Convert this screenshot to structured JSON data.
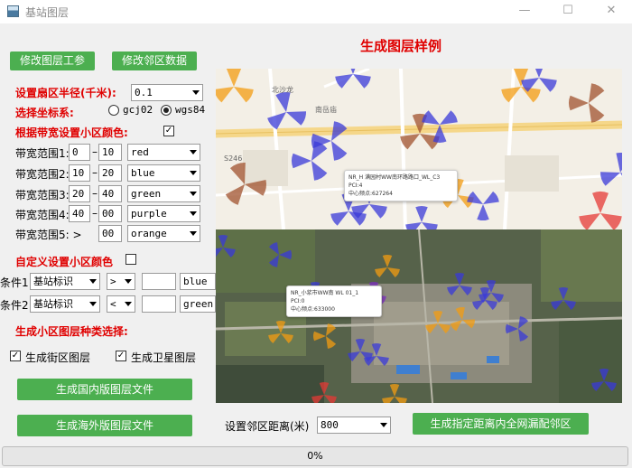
{
  "window": {
    "title": "基站图层",
    "minimize": "—",
    "maximize": "☐",
    "close": "✕"
  },
  "toolbar": {
    "modify_params": "修改图层工参",
    "modify_neighbor": "修改邻区数据"
  },
  "preview_title": "生成图层样例",
  "sector_radius": {
    "label": "设置扇区半径(千米):",
    "value": "0.1"
  },
  "coord": {
    "label": "选择坐标系:",
    "options": [
      "gcj02",
      "wgs84"
    ],
    "selected": "wgs84"
  },
  "bandwidth_color": {
    "label": "根据带宽设置小区颜色:",
    "checked": true
  },
  "ranges": [
    {
      "label": "带宽范围1:",
      "from": "0",
      "to": "10",
      "color": "red"
    },
    {
      "label": "带宽范围2:",
      "from": "10",
      "to": "20",
      "color": "blue"
    },
    {
      "label": "带宽范围3:",
      "from": "20",
      "to": "40",
      "color": "green"
    },
    {
      "label": "带宽范围4:",
      "from": "40",
      "to": "00",
      "color": "purple"
    },
    {
      "label": "带宽范围5: >",
      "from": "",
      "to": "00",
      "color": "orange"
    }
  ],
  "range_sep": "–",
  "custom_color": {
    "label": "自定义设置小区颜色",
    "checked": false
  },
  "conditions": [
    {
      "label": "条件1",
      "field": "基站标识",
      "op": ">",
      "value": "",
      "color": "blue"
    },
    {
      "label": "条件2",
      "field": "基站标识",
      "op": "<",
      "value": "",
      "color": "green"
    }
  ],
  "layer_types": {
    "label": "生成小区图层种类选择:",
    "street": {
      "label": "生成街区图层",
      "checked": true
    },
    "satellite": {
      "label": "生成卫星图层",
      "checked": true
    }
  },
  "buttons": {
    "domestic": "生成国内版图层文件",
    "overseas": "生成海外版图层文件",
    "match_neighbors": "生成指定距离内全网漏配邻区"
  },
  "neighbor_distance": {
    "label": "设置邻区距离(米)",
    "value": "800"
  },
  "progress": {
    "value": 0,
    "text": "0%"
  },
  "map": {
    "street_labels": [
      "S246",
      "南岳庙",
      "北沙龙"
    ],
    "popup1": [
      "NR_H 满园村WW南环路路口_WL_C3",
      "PCI:4",
      "中心频点:627264"
    ],
    "popup2": [
      "NR_小浆市WW南 WL 01_1",
      "PCI:0",
      "中心频点:633000"
    ],
    "colors": {
      "red": "#e53935",
      "blue": "#3a3ad8",
      "orange": "#f39c12",
      "brown": "#a0522d",
      "purple": "#7b2cbf"
    }
  }
}
